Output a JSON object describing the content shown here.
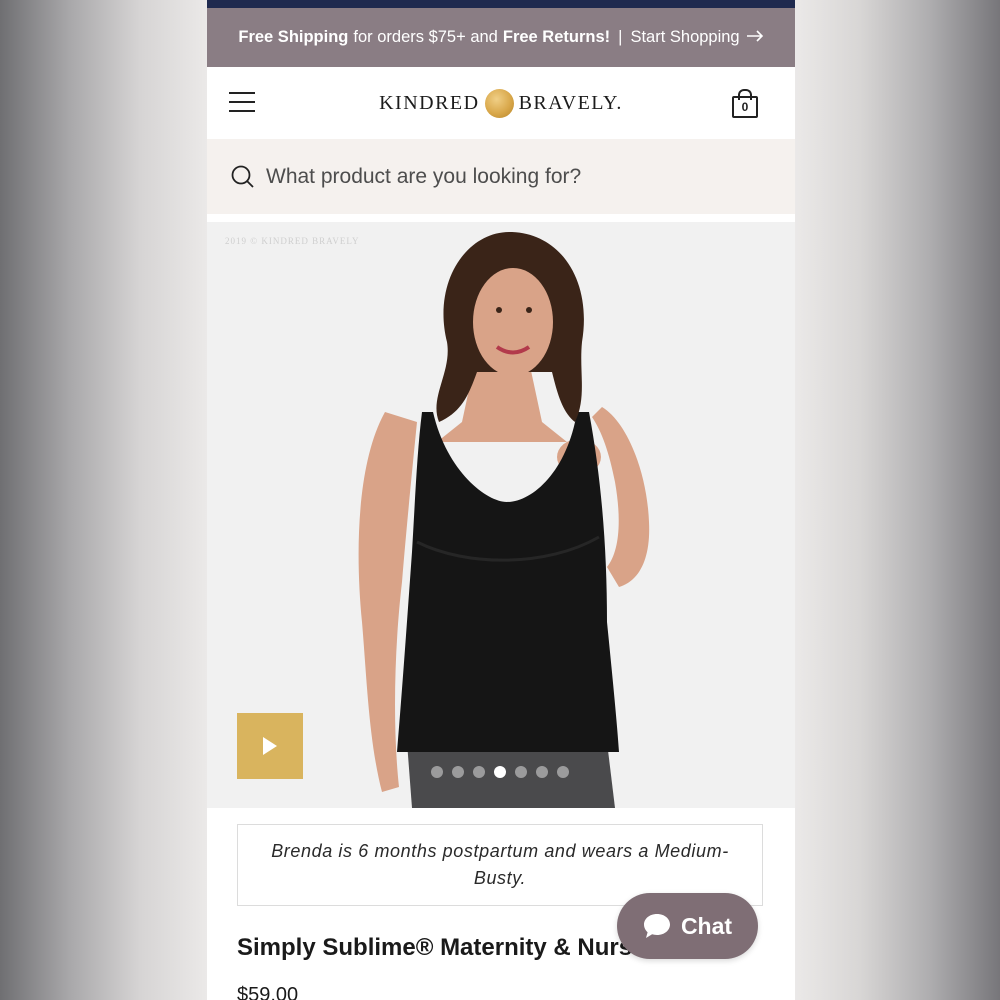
{
  "promo": {
    "free_shipping": "Free Shipping",
    "orders_text": "for orders $75+ and",
    "free_returns": "Free Returns!",
    "separator": "|",
    "start_shopping": "Start Shopping"
  },
  "header": {
    "logo_left": "KINDRED",
    "logo_right": "BRAVELY.",
    "cart_count": "0"
  },
  "search": {
    "placeholder": "What product are you looking for?"
  },
  "hero": {
    "copyright": "2019 © KINDRED BRAVELY",
    "carousel": {
      "total": 7,
      "active_index": 3
    }
  },
  "product": {
    "caption": "Brenda is 6 months postpartum and wears a Medium-Busty.",
    "title": "Simply Sublime® Maternity & Nurs",
    "price": "$59.00"
  },
  "chat": {
    "label": "Chat"
  },
  "colors": {
    "top_bar": "#1f2a4f",
    "promo_bar": "#8a7d84",
    "search_bg": "#f5f1ee",
    "play_button": "#d9b45e",
    "chat_button": "#7f6e75"
  }
}
